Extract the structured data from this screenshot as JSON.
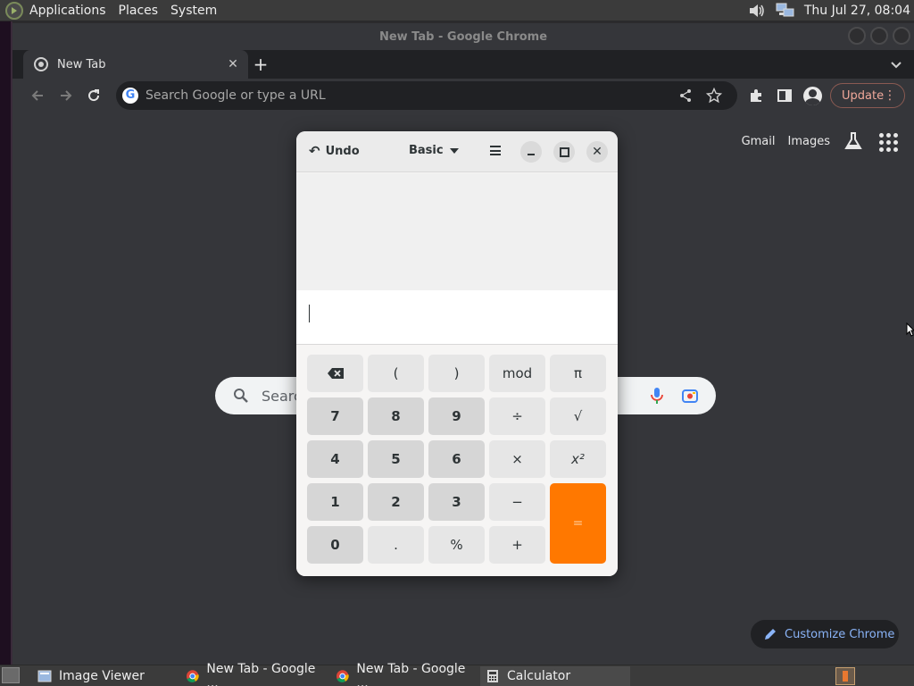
{
  "top_panel": {
    "menus": [
      "Applications",
      "Places",
      "System"
    ],
    "clock": "Thu Jul 27, 08:04"
  },
  "chrome": {
    "window_title": "New Tab - Google Chrome",
    "tab_label": "New Tab",
    "omnibox_placeholder": "Search Google or type a URL",
    "update_label": "Update",
    "ntp": {
      "gmail": "Gmail",
      "images": "Images",
      "search_placeholder": "Searc",
      "customize": "Customize Chrome"
    }
  },
  "calculator": {
    "undo_label": "Undo",
    "mode_label": "Basic",
    "display_value": "",
    "keys": {
      "r1": [
        "⌫",
        "(",
        ")",
        "mod",
        "π"
      ],
      "r2": [
        "7",
        "8",
        "9",
        "÷",
        "√"
      ],
      "r3": [
        "4",
        "5",
        "6",
        "×",
        "x²"
      ],
      "r4": [
        "1",
        "2",
        "3",
        "−"
      ],
      "r5": [
        "0",
        ".",
        "%",
        "+"
      ],
      "equals": "="
    }
  },
  "taskbar": {
    "tasks": [
      "Image Viewer",
      "New Tab - Google ...",
      "New Tab - Google ...",
      "Calculator"
    ]
  },
  "colors": {
    "accent_equals": "#ff7800",
    "chrome_bg": "#35363a",
    "update_text": "#f0a89a",
    "customize_text": "#8ab4f8"
  }
}
